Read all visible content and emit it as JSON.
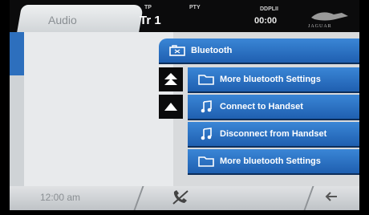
{
  "status_bar": {
    "source_tab": "Audio",
    "tp_label": "TP",
    "pty_label": "PTY",
    "track": "Tr 1",
    "time_indicator_label": "DDPLII",
    "time": "00:00",
    "brand": "JAGUAR"
  },
  "menu": {
    "header": "Bluetooth",
    "items": [
      {
        "label": "More bluetooth Settings",
        "icon": "folder-icon"
      },
      {
        "label": "Connect to Handset",
        "icon": "music-note-icon"
      },
      {
        "label": "Disconnect from Handset",
        "icon": "music-note-icon"
      },
      {
        "label": "More bluetooth Settings",
        "icon": "folder-icon"
      }
    ]
  },
  "bottom_bar": {
    "clock": "12:00 am"
  },
  "colors": {
    "row_blue": "#2b73c6",
    "status_black": "#0b0b0c",
    "panel_grey": "#d8dadc"
  }
}
